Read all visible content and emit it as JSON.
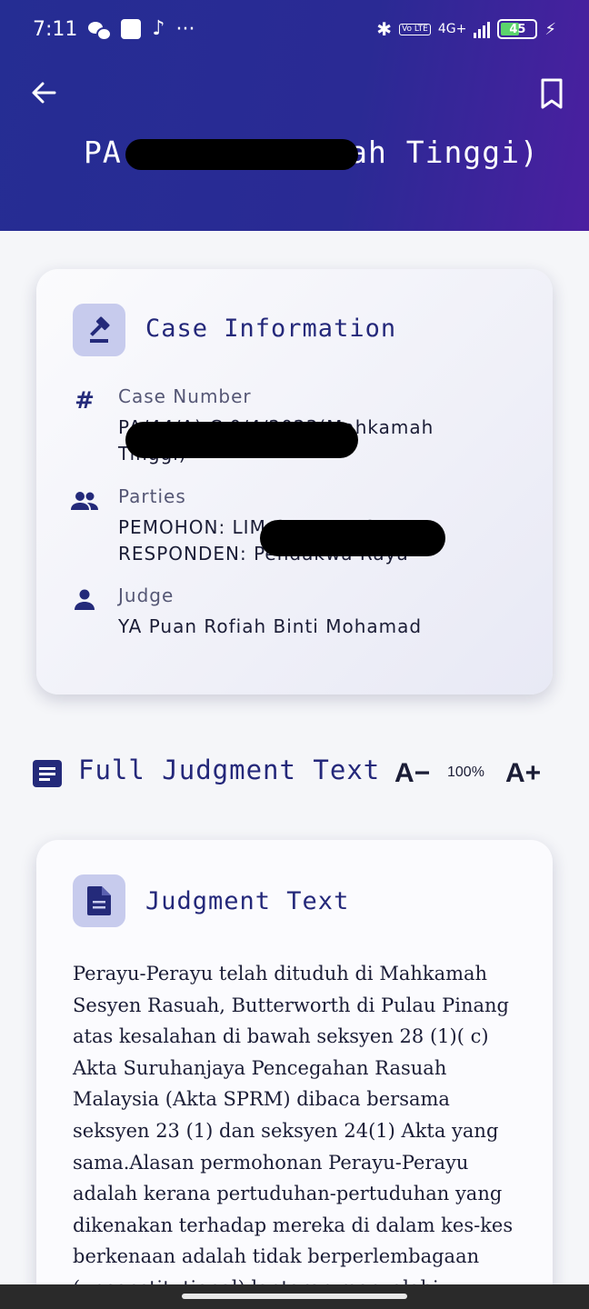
{
  "status_bar": {
    "time": "7:11",
    "dots": "···",
    "network": "4G+",
    "volte": "Vo LTE",
    "battery": "45"
  },
  "header": {
    "title": "PA                              2023(Mahkamah Tinggi)",
    "back_icon": "arrow-left-icon",
    "bookmark_icon": "bookmark-icon",
    "colors": {
      "gradient_start": "#252d93",
      "gradient_end": "#4b1fa0"
    }
  },
  "case_card": {
    "title": "Case Information",
    "icon": "gavel-icon",
    "fields": [
      {
        "label": "Case Number",
        "value_line1": "PA/44/A) C 0/4/2023(Mahkamah",
        "value_line2": "Tinggi)",
        "icon": "hash-icon"
      },
      {
        "label": "Parties",
        "value_line1": "PEMOHON: LIM CHAI LEAS",
        "value_line2": "RESPONDEN: Pendakwa Raya",
        "icon": "people-icon"
      },
      {
        "label": "Judge",
        "value_line1": "YA Puan Rofiah Binti Mohamad",
        "icon": "person-icon"
      }
    ]
  },
  "section": {
    "title": "Full Judgment Text",
    "font_minus": "A−",
    "zoom": "100%",
    "font_plus": "A+"
  },
  "judgment_card": {
    "title": "Judgment Text",
    "icon": "document-icon",
    "body": "Perayu-Perayu telah dituduh di Mahkamah Sesyen Rasuah, Butterworth di Pulau Pinang atas kesalahan di bawah seksyen 28 (1)( c) Akta Suruhanjaya Pencegahan Rasuah Malaysia (Akta SPRM) dibaca bersama seksyen 23 (1) dan seksyen 24(1) Akta yang sama.Alasan permohonan Perayu-Perayu adalah kerana pertuduhan-pertuduhan yang dikenakan terhadap mereka di dalam kes-kes berkenaan adalah  tidak berperlembagaan (unconstitutional) lantaran menyalahi"
  }
}
